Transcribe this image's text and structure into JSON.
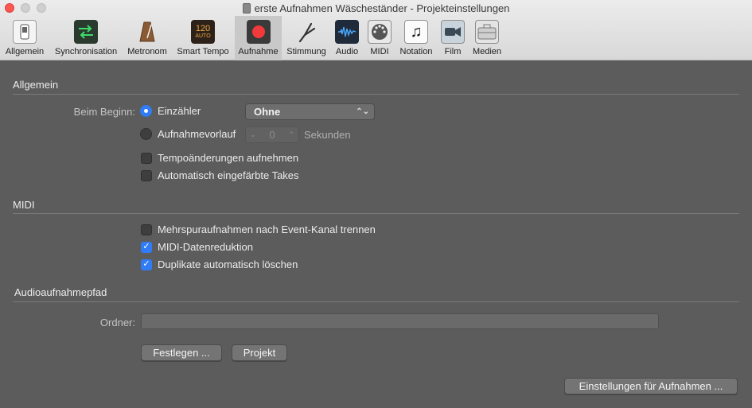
{
  "window": {
    "title": "erste Aufnahmen Wäscheständer - Projekteinstellungen"
  },
  "toolbar": {
    "tabs": [
      {
        "label": "Allgemein",
        "icon": "switch-icon"
      },
      {
        "label": "Synchronisation",
        "icon": "sync-arrows-icon"
      },
      {
        "label": "Metronom",
        "icon": "metronome-icon"
      },
      {
        "label": "Smart Tempo",
        "icon": "smart-tempo-icon",
        "icon_text": "120",
        "icon_subtext": "AUTO"
      },
      {
        "label": "Aufnahme",
        "icon": "record-icon",
        "active": true
      },
      {
        "label": "Stimmung",
        "icon": "tuning-fork-icon"
      },
      {
        "label": "Audio",
        "icon": "waveform-icon"
      },
      {
        "label": "MIDI",
        "icon": "midi-connector-icon"
      },
      {
        "label": "Notation",
        "icon": "music-note-icon"
      },
      {
        "label": "Film",
        "icon": "video-camera-icon"
      },
      {
        "label": "Medien",
        "icon": "briefcase-icon"
      }
    ]
  },
  "general": {
    "title": "Allgemein",
    "start_label": "Beim Beginn:",
    "count_in_label": "Einzähler",
    "count_in_select": "Ohne",
    "preroll_label": "Aufnahmevorlauf",
    "preroll_value": "0",
    "preroll_unit": "Sekunden",
    "record_tempo_label": "Tempoänderungen aufnehmen",
    "auto_colored_label": "Automatisch eingefärbte Takes"
  },
  "midi": {
    "title": "MIDI",
    "split_label": "Mehrspuraufnahmen nach Event-Kanal trennen",
    "reduction_label": "MIDI-Datenreduktion",
    "duplicates_label": "Duplikate automatisch löschen"
  },
  "audio_path": {
    "title": "Audioaufnahmepfad",
    "folder_label": "Ordner:",
    "folder_value": "",
    "set_button": "Festlegen ...",
    "project_button": "Projekt"
  },
  "footer": {
    "recording_settings_button": "Einstellungen für Aufnahmen ..."
  },
  "colors": {
    "accent": "#2f7cf6",
    "record_red": "#f23a3a",
    "background": "#5c5c5c"
  }
}
